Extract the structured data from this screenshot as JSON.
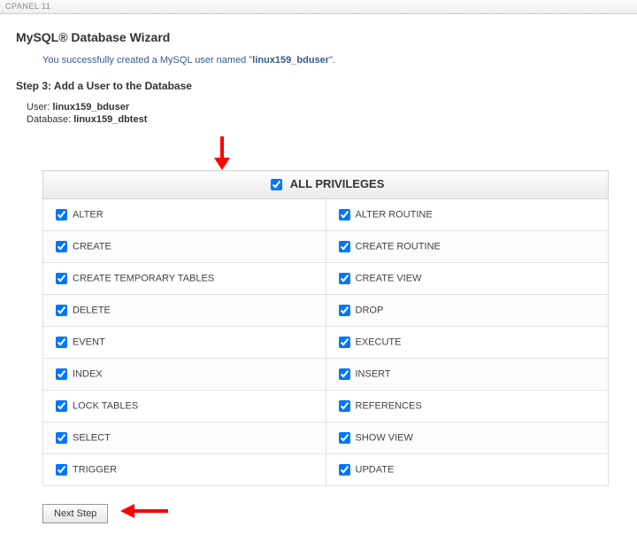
{
  "topbar": {
    "label": "CPANEL 11"
  },
  "title": "MySQL® Database Wizard",
  "success_prefix": "You successfully created a MySQL user named \"",
  "success_user": "linux159_bduser",
  "success_suffix": "\".",
  "step_heading": "Step 3: Add a User to the Database",
  "user_label": "User:",
  "user_value": "linux159_bduser",
  "db_label": "Database:",
  "db_value": "linux159_dbtest",
  "all_priv_label": "ALL PRIVILEGES",
  "privileges": [
    {
      "left": "ALTER",
      "right": "ALTER ROUTINE"
    },
    {
      "left": "CREATE",
      "right": "CREATE ROUTINE"
    },
    {
      "left": "CREATE TEMPORARY TABLES",
      "right": "CREATE VIEW"
    },
    {
      "left": "DELETE",
      "right": "DROP"
    },
    {
      "left": "EVENT",
      "right": "EXECUTE"
    },
    {
      "left": "INDEX",
      "right": "INSERT"
    },
    {
      "left": "LOCK TABLES",
      "right": "REFERENCES"
    },
    {
      "left": "SELECT",
      "right": "SHOW VIEW"
    },
    {
      "left": "TRIGGER",
      "right": "UPDATE"
    }
  ],
  "next_button": "Next Step"
}
